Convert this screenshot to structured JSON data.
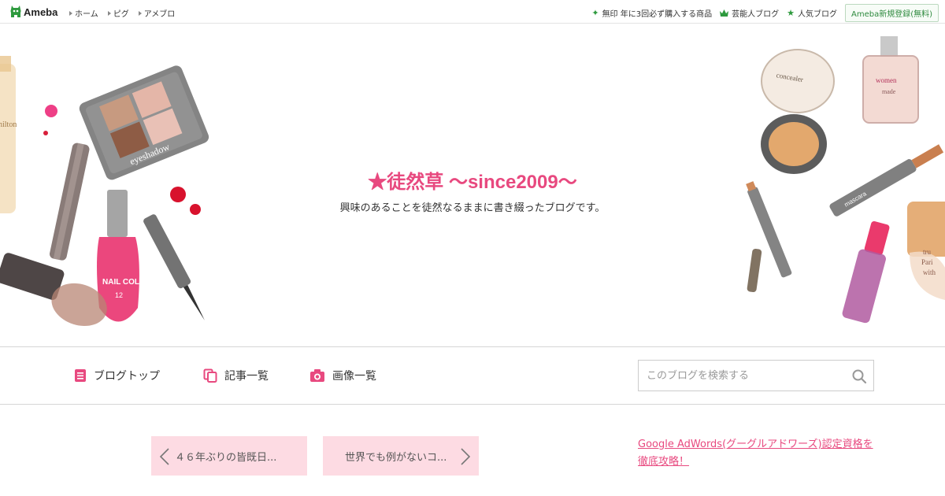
{
  "topbar": {
    "logo_text": "Ameba",
    "nav": [
      "ホーム",
      "ピグ",
      "アメブロ"
    ],
    "links": [
      {
        "label": "無印 年に3回必ず購入する商品",
        "icon": "sparkle-icon"
      },
      {
        "label": "芸能人ブログ",
        "icon": "crown-icon"
      },
      {
        "label": "人気ブログ",
        "icon": "star-icon"
      }
    ],
    "register_label": "Ameba新規登録(無料)"
  },
  "header": {
    "title": "★徒然草 ～since2009～",
    "description": "興味のあることを徒然なるままに書き綴ったブログです。",
    "art_labels": [
      "eyeshadow",
      "NAIL COLOR",
      "12",
      "women",
      "made",
      "concealer",
      "mascara",
      "hilton",
      "tru",
      "Pari",
      "with"
    ]
  },
  "nav": {
    "items": [
      {
        "label": "ブログトップ",
        "icon": "document-icon"
      },
      {
        "label": "記事一覧",
        "icon": "copy-icon"
      },
      {
        "label": "画像一覧",
        "icon": "camera-icon"
      }
    ],
    "search_placeholder": "このブログを検索する"
  },
  "pager": {
    "prev_label": "４６年ぶりの皆既日...",
    "next_label": "世界でも例がないコ..."
  },
  "ad": {
    "text": "Google AdWords(グーグルアドワーズ)認定資格を徹底攻略！"
  },
  "colors": {
    "accent": "#e8497f",
    "pager_bg": "#fddbe3",
    "ameba_green": "#2e9a3e"
  }
}
